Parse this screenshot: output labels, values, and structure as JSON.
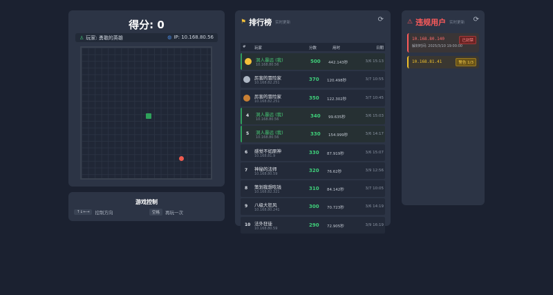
{
  "game": {
    "score_label": "得分: 0",
    "player_label": "玩家: 勇敢的英雄",
    "ip_label": "IP: 10.168.80.56"
  },
  "controls": {
    "title": "游戏控制",
    "items": [
      {
        "key": "↑↓←→",
        "label": "控制方向"
      },
      {
        "key": "空格",
        "label": "再玩一次"
      }
    ]
  },
  "leaderboard": {
    "title": "排行榜",
    "subtitle": "实时更新",
    "columns": [
      "#",
      "玩家",
      "分数",
      "用时",
      "日期"
    ],
    "rows": [
      {
        "rank": "",
        "medal": "gold",
        "name": "洞人暴远 (我)",
        "ip": "10.168.80.56",
        "score": "500",
        "time": "442.143秒",
        "date": "3/6 15:13",
        "me": true
      },
      {
        "rank": "",
        "medal": "silver",
        "name": "厉害的冒险家",
        "ip": "10.168.82.251",
        "score": "370",
        "time": "120.498秒",
        "date": "3/7 10:55",
        "me": false
      },
      {
        "rank": "",
        "medal": "bronze",
        "name": "厉害的冒险家",
        "ip": "10.168.82.251",
        "score": "350",
        "time": "122.302秒",
        "date": "3/7 10:45",
        "me": false
      },
      {
        "rank": "4",
        "medal": "",
        "name": "洞人暴远 (我)",
        "ip": "10.168.80.56",
        "score": "340",
        "time": "99.635秒",
        "date": "3/6 15:03",
        "me": true
      },
      {
        "rank": "5",
        "medal": "",
        "name": "洞人暴远 (我)",
        "ip": "10.168.80.56",
        "score": "330",
        "time": "154.999秒",
        "date": "3/6 14:17",
        "me": true
      },
      {
        "rank": "6",
        "medal": "",
        "name": "感觉不如原神",
        "ip": "10.168.81.9",
        "score": "330",
        "time": "87.919秒",
        "date": "3/6 15:07",
        "me": false
      },
      {
        "rank": "7",
        "medal": "",
        "name": "神秘的法师",
        "ip": "10.168.80.59",
        "score": "320",
        "time": "76.62秒",
        "date": "3/9 12:56",
        "me": false
      },
      {
        "rank": "8",
        "medal": "",
        "name": "策划我想吃钱",
        "ip": "10.168.82.321",
        "score": "310",
        "time": "84.142秒",
        "date": "3/7 10:05",
        "me": false
      },
      {
        "rank": "9",
        "medal": "",
        "name": "八级大狂风",
        "ip": "10.168.80.241",
        "score": "300",
        "time": "70.723秒",
        "date": "3/6 14:19",
        "me": false
      },
      {
        "rank": "10",
        "medal": "",
        "name": "法外狂徒",
        "ip": "10.168.80.59",
        "score": "290",
        "time": "72.905秒",
        "date": "3/9 16:19",
        "me": false
      }
    ]
  },
  "violations": {
    "title": "违规用户",
    "subtitle": "实时更新",
    "items": [
      {
        "ip": "10.168.80.140",
        "badge": "已封禁",
        "meta": "解封时间: 2025/3/10 19:00:00",
        "kind": "ban"
      },
      {
        "ip": "10.168.81.41",
        "badge": "警告 1/3",
        "meta": "",
        "kind": "warn"
      }
    ]
  },
  "colors": {
    "accent_green": "#3fcf7a",
    "ban_red": "#ff5b5b",
    "warn_yellow": "#f0c02a",
    "gold": "#f3c03a",
    "silver": "#aeb7c4",
    "bronze": "#c98034"
  },
  "icons": {
    "player": "user-icon",
    "ip": "globe-icon",
    "leaderboard": "trophy-icon",
    "violations": "warning-icon",
    "refresh": "refresh-icon"
  }
}
